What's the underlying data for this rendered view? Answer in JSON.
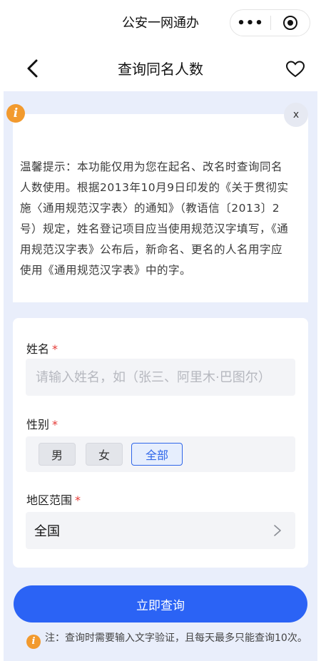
{
  "app": {
    "title": "公安一网通办",
    "more_icon": "more-dots-icon",
    "close_icon": "mini-program-close-icon"
  },
  "nav": {
    "page_title": "查询同名人数",
    "back_icon": "chevron-left-icon",
    "favorite_icon": "heart-icon"
  },
  "tip": {
    "icon": "info-icon",
    "close_label": "x",
    "text": "温馨提示：本功能仅用为您在起名、改名时查询同名人数使用。根据2013年10月9日印发的《关于贯彻实施〈通用规范汉字表〉的通知》（教语信〔2013〕2号）规定，姓名登记项目应当使用规范汉字填写，《通用规范汉字表》公布后，新命名、更名的人名用字应使用《通用规范汉字表》中的字。"
  },
  "form": {
    "name": {
      "label": "姓名",
      "required_mark": "*",
      "value": "",
      "placeholder": "请输入姓名，如（张三、阿里木·巴图尔）"
    },
    "gender": {
      "label": "性别",
      "required_mark": "*",
      "options": [
        "男",
        "女",
        "全部"
      ],
      "selected": "全部"
    },
    "region": {
      "label": "地区范围",
      "required_mark": "*",
      "value": "全国",
      "chevron": ">"
    }
  },
  "submit_label": "立即查询",
  "note": {
    "text": "注：查询时需要输入文字验证，且每天最多只能查询10次。"
  },
  "colors": {
    "primary": "#2b63f5",
    "warning": "#f29a2e",
    "required": "#e53935",
    "background": "#e9eefb"
  }
}
